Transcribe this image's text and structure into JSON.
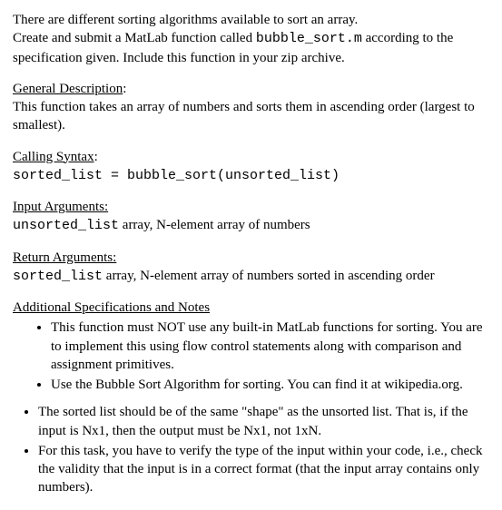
{
  "intro": {
    "line1": "There are different sorting algorithms available to sort an array.",
    "line2_pre": "Create and submit a MatLab function called ",
    "line2_code": "bubble_sort.m",
    "line2_post": " according to the specification given.  Include this function in your zip archive."
  },
  "general": {
    "heading": "General Description",
    "colon": ":",
    "body": "This function takes an array of numbers and sorts them in ascending order (largest to smallest)."
  },
  "calling": {
    "heading": "Calling Syntax",
    "colon": ":",
    "code": "sorted_list = bubble_sort(unsorted_list)"
  },
  "input": {
    "heading": "Input Arguments:",
    "code": "unsorted_list",
    "desc": " array, N-element array of numbers"
  },
  "return": {
    "heading": "Return Arguments:",
    "code": "sorted_list",
    "desc": " array, N-element array of numbers sorted in ascending order"
  },
  "additional": {
    "heading": "Additional Specifications and Notes",
    "bullets_inner": [
      "This function must NOT use any built-in MatLab functions for sorting. You are to implement this using flow control statements along with comparison and assignment primitives.",
      "Use the Bubble Sort Algorithm for sorting.  You can find it at wikipedia.org."
    ],
    "bullets_outer": [
      "The sorted list should be of the same \"shape\" as the unsorted list.  That is, if the input is Nx1, then the output must be Nx1, not 1xN.",
      "For this task, you have to verify the type of the input within your code, i.e., check the validity that the input is in a correct format (that the input array contains only numbers)."
    ]
  }
}
